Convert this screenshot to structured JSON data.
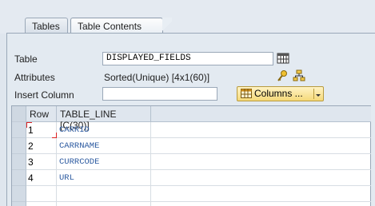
{
  "tabs": [
    {
      "label": "Tables"
    },
    {
      "label": "Table Contents"
    }
  ],
  "form": {
    "table_label": "Table",
    "table_value": "DISPLAYED_FIELDS",
    "attributes_label": "Attributes",
    "attributes_value": "Sorted(Unique) [4x1(60)]",
    "insert_column_label": "Insert Column",
    "insert_column_value": "",
    "columns_button": "Columns ..."
  },
  "grid": {
    "headers": [
      "Row",
      "TABLE_LINE [C(30)]"
    ],
    "rows": [
      {
        "row": "1",
        "value": "CARRID"
      },
      {
        "row": "2",
        "value": "CARRNAME"
      },
      {
        "row": "3",
        "value": "CURRCODE"
      },
      {
        "row": "4",
        "value": "URL"
      }
    ]
  },
  "colors": {
    "accent": "#f5d97a",
    "cell_text": "#2c5aa0",
    "background": "#dfe6ee"
  },
  "icons": [
    "table-icon",
    "key-icon",
    "hierarchy-icon",
    "columns-grid-icon",
    "dropdown-arrow-icon"
  ]
}
